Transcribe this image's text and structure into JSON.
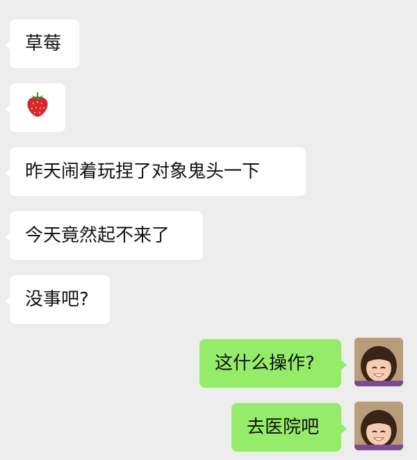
{
  "chat": {
    "messages": [
      {
        "side": "left",
        "text": "草莓"
      },
      {
        "side": "left",
        "emoji": "strawberry-icon"
      },
      {
        "side": "left",
        "text": "昨天闹着玩捏了对象鬼头一下"
      },
      {
        "side": "left",
        "text": "今天竟然起不来了"
      },
      {
        "side": "left",
        "text": "没事吧?"
      },
      {
        "side": "right",
        "text": "这什么操作?"
      },
      {
        "side": "right",
        "text": "去医院吧"
      }
    ]
  },
  "colors": {
    "background": "#ededed",
    "incoming_bubble": "#ffffff",
    "outgoing_bubble": "#95ec69"
  }
}
